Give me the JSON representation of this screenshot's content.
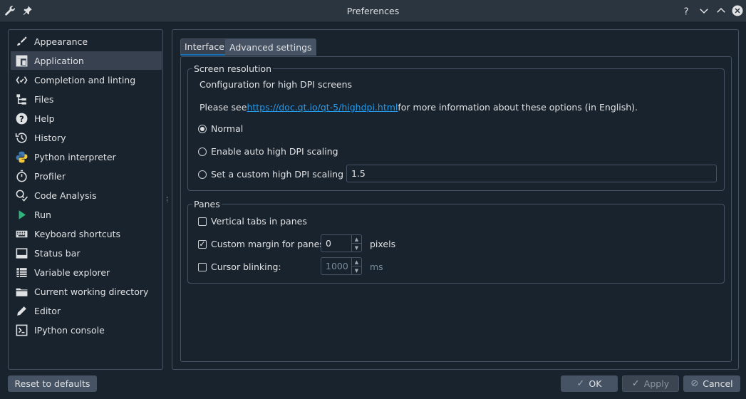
{
  "window": {
    "title": "Preferences"
  },
  "sidebar": {
    "items": [
      {
        "label": "Appearance",
        "icon": "paintbrush-icon"
      },
      {
        "label": "Application",
        "icon": "application-layout-icon",
        "selected": true
      },
      {
        "label": "Completion and linting",
        "icon": "completion-icon"
      },
      {
        "label": "Files",
        "icon": "files-tree-icon"
      },
      {
        "label": "Help",
        "icon": "help-icon"
      },
      {
        "label": "History",
        "icon": "history-icon"
      },
      {
        "label": "Python interpreter",
        "icon": "python-icon"
      },
      {
        "label": "Profiler",
        "icon": "stopwatch-icon"
      },
      {
        "label": "Code Analysis",
        "icon": "code-analysis-icon"
      },
      {
        "label": "Run",
        "icon": "run-icon"
      },
      {
        "label": "Keyboard shortcuts",
        "icon": "keyboard-icon"
      },
      {
        "label": "Status bar",
        "icon": "status-bar-icon"
      },
      {
        "label": "Variable explorer",
        "icon": "variable-explorer-icon"
      },
      {
        "label": "Current working directory",
        "icon": "folder-icon"
      },
      {
        "label": "Editor",
        "icon": "editor-icon"
      },
      {
        "label": "IPython console",
        "icon": "console-icon"
      }
    ]
  },
  "tabs": [
    {
      "label": "Interface",
      "active": true
    },
    {
      "label": "Advanced settings",
      "active": false
    }
  ],
  "screen_resolution": {
    "title": "Screen resolution",
    "description": "Configuration for high DPI screens",
    "info_prefix": "Please see ",
    "info_link": "https://doc.qt.io/qt-5/highdpi.html",
    "info_suffix": " for more information about these options (in English).",
    "options": [
      {
        "label": "Normal",
        "checked": true
      },
      {
        "label": "Enable auto high DPI scaling",
        "checked": false
      },
      {
        "label": "Set a custom high DPI scaling",
        "checked": false
      }
    ],
    "custom_scaling_value": "1.5"
  },
  "panes": {
    "title": "Panes",
    "vertical_tabs_label": "Vertical tabs in panes",
    "vertical_tabs_checked": false,
    "custom_margin_label": "Custom margin for panes:",
    "custom_margin_checked": true,
    "custom_margin_value": "0",
    "custom_margin_unit": "pixels",
    "cursor_blinking_label": "Cursor blinking:",
    "cursor_blinking_checked": false,
    "cursor_blinking_value": "1000",
    "cursor_blinking_unit": "ms"
  },
  "buttons": {
    "reset": "Reset to defaults",
    "ok": "OK",
    "apply": "Apply",
    "cancel": "Cancel"
  },
  "colors": {
    "background": "#19232d",
    "border": "#455364",
    "selection": "#37414f",
    "accent": "#1a72bb",
    "link": "#259ae9"
  }
}
